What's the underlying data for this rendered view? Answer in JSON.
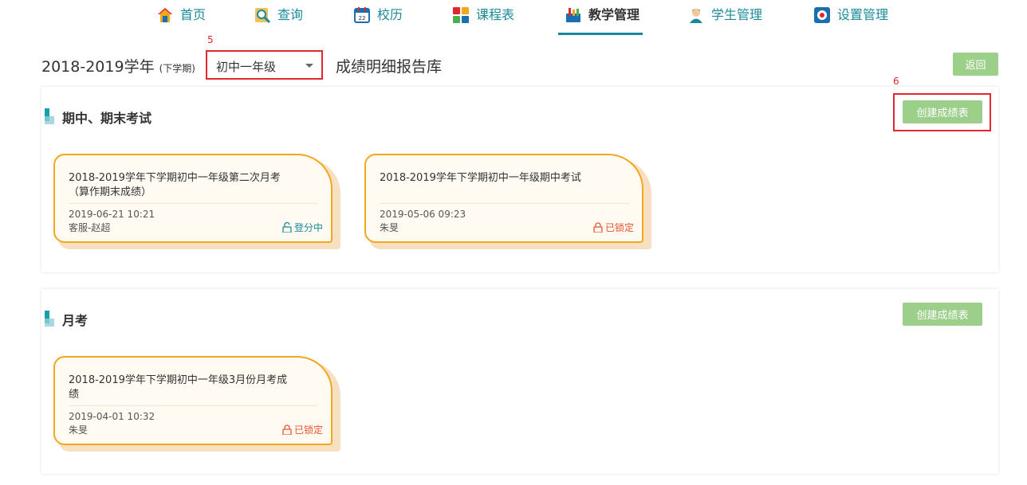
{
  "nav": [
    {
      "label": "首页",
      "icon": "home-icon",
      "active": false
    },
    {
      "label": "查询",
      "icon": "query-icon",
      "active": false
    },
    {
      "label": "校历",
      "icon": "calendar-icon",
      "active": false
    },
    {
      "label": "课程表",
      "icon": "timetable-icon",
      "active": false
    },
    {
      "label": "教学管理",
      "icon": "teaching-icon",
      "active": true
    },
    {
      "label": "学生管理",
      "icon": "student-icon",
      "active": false
    },
    {
      "label": "设置管理",
      "icon": "settings-icon",
      "active": false
    }
  ],
  "header": {
    "term": "2018-2019学年",
    "semester": "(下学期)",
    "grade": "初中一年级",
    "library": "成绩明细报告库",
    "back_label": "返回"
  },
  "markers": {
    "grade": "5",
    "create": "6"
  },
  "sections": [
    {
      "title": "期中、期末考试",
      "create_label": "创建成绩表",
      "cards": [
        {
          "title": "2018-2019学年下学期初中一年级第二次月考（算作期末成绩）",
          "date": "2019-06-21 10:21",
          "user": "客服-赵超",
          "status": "登分中",
          "status_type": "open"
        },
        {
          "title": "2018-2019学年下学期初中一年级期中考试",
          "date": "2019-05-06 09:23",
          "user": "朱旻",
          "status": "已锁定",
          "status_type": "locked"
        }
      ]
    },
    {
      "title": "月考",
      "create_label": "创建成绩表",
      "cards": [
        {
          "title": "2018-2019学年下学期初中一年级3月份月考成绩",
          "date": "2019-04-01 10:32",
          "user": "朱旻",
          "status": "已锁定",
          "status_type": "locked"
        }
      ]
    }
  ],
  "colors": {
    "accent": "#1a8a9a",
    "button": "#9ccf8a",
    "card_border": "#f2a81d",
    "highlight": "#e0282e",
    "lock": "#e8522b"
  }
}
